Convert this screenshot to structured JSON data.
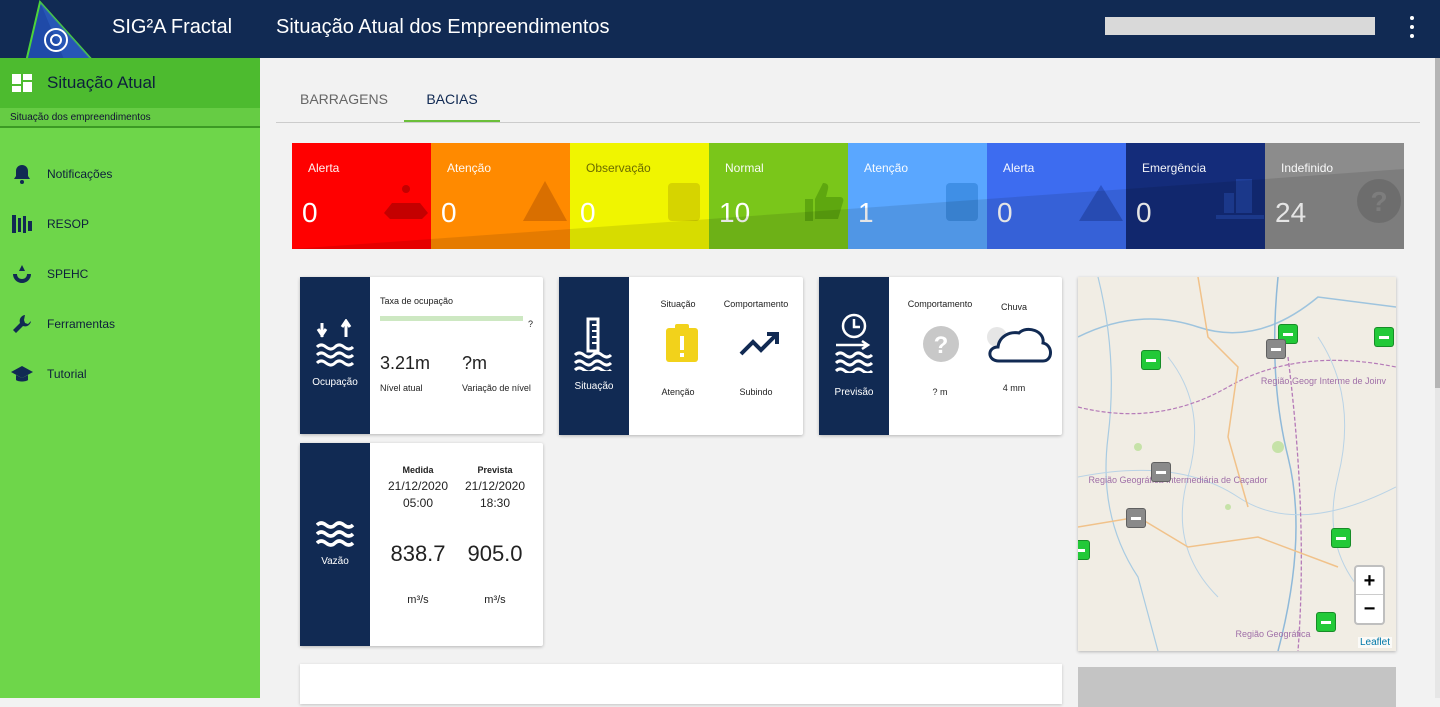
{
  "app": {
    "title": "SIG²A Fractal",
    "page_title": "Situação Atual dos Empreendimentos"
  },
  "sidebar": {
    "header": "Situação Atual",
    "subheader": "Situação dos empreendimentos",
    "items": [
      {
        "label": "Notificações",
        "icon": "bell-icon"
      },
      {
        "label": "RESOP",
        "icon": "resop-icon"
      },
      {
        "label": "SPEHC",
        "icon": "spehc-icon"
      },
      {
        "label": "Ferramentas",
        "icon": "wrench-icon"
      },
      {
        "label": "Tutorial",
        "icon": "graduation-cap-icon"
      }
    ]
  },
  "tabs": [
    {
      "label": "BARRAGENS",
      "active": false
    },
    {
      "label": "BACIAS",
      "active": true
    }
  ],
  "status": [
    {
      "label": "Alerta",
      "count": "0",
      "color": "#ff0000",
      "icon": "dam-alert-icon"
    },
    {
      "label": "Atenção",
      "count": "0",
      "color": "#ff8a00",
      "icon": "warning-icon"
    },
    {
      "label": "Observação",
      "count": "0",
      "color": "#f0f500",
      "icon": "exclamation-clipboard-icon"
    },
    {
      "label": "Normal",
      "count": "10",
      "color": "#7ac61a",
      "icon": "thumbs-up-icon"
    },
    {
      "label": "Atenção",
      "count": "1",
      "color": "#5aa7ff",
      "icon": "exclamation-clipboard-icon"
    },
    {
      "label": "Alerta",
      "count": "0",
      "color": "#3d6cf0",
      "icon": "warning-icon"
    },
    {
      "label": "Emergência",
      "count": "0",
      "color": "#142c7a",
      "icon": "flooded-city-icon"
    },
    {
      "label": "Indefinido",
      "count": "24",
      "color": "#8c8c8c",
      "icon": "question-icon"
    }
  ],
  "cards": {
    "ocupacao": {
      "side_label": "Ocupação",
      "rate_label": "Taxa de ocupação",
      "rate_value": "?",
      "nivel_value": "3.21m",
      "nivel_label": "Nível atual",
      "variacao_value": "?m",
      "variacao_label": "Variação de nível"
    },
    "situacao": {
      "side_label": "Situação",
      "situacao_header": "Situação",
      "comportamento_header": "Comportamento",
      "situacao_value": "Atenção",
      "comportamento_value": "Subindo"
    },
    "previsao": {
      "side_label": "Previsão",
      "comportamento_header": "Comportamento",
      "chuva_header": "Chuva",
      "comportamento_value": "? m",
      "chuva_value": "4 mm"
    },
    "vazao": {
      "side_label": "Vazão",
      "medida_header": "Medida",
      "medida_date": "21/12/2020",
      "medida_time": "05:00",
      "medida_value": "838.7",
      "medida_unit": "m³/s",
      "prevista_header": "Prevista",
      "prevista_date": "21/12/2020",
      "prevista_time": "18:30",
      "prevista_value": "905.0",
      "prevista_unit": "m³/s"
    }
  },
  "map": {
    "labels": [
      "Região Geográfica Intermediária de Caçador",
      "Região Geogr Interme de Joinv",
      "Região Geográfica"
    ],
    "zoom_in": "+",
    "zoom_out": "−",
    "attribution": "Leaflet"
  }
}
